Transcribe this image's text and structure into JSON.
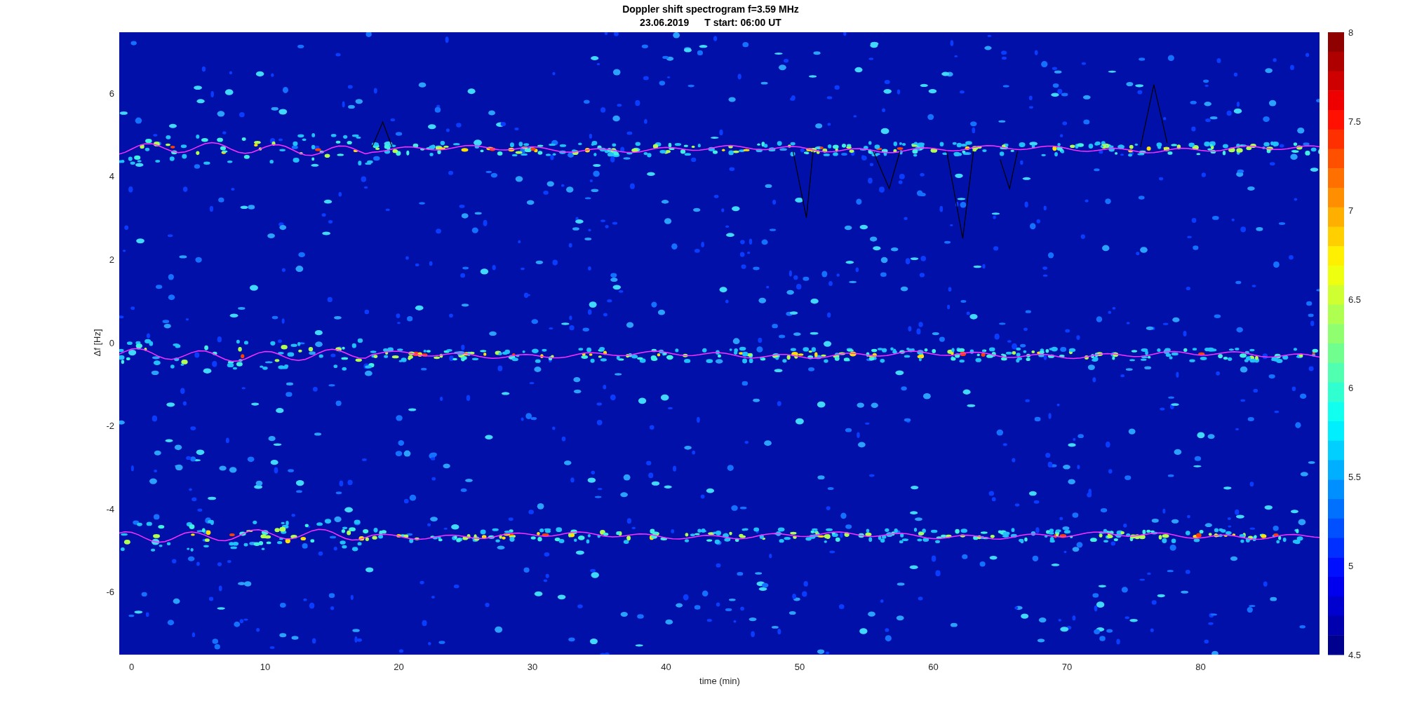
{
  "figure": {
    "title": "Doppler shift spectrogram f=3.59 MHz",
    "subtitle_parts": [
      "23.06.2019",
      "T start: 06:00 UT"
    ],
    "axes": {
      "xlabel": "time (min)",
      "ylabel": "Δf [Hz]",
      "xticks": [
        "0",
        "10",
        "20",
        "30",
        "40",
        "50",
        "60",
        "70",
        "80"
      ],
      "yticks": [
        "6",
        "4",
        "2",
        "0",
        "-2",
        "-4",
        "-6"
      ]
    },
    "colorbar": {
      "ticks": [
        "8",
        "7.5",
        "7",
        "6.5",
        "6",
        "5.5",
        "5",
        "4.5"
      ]
    }
  }
}
